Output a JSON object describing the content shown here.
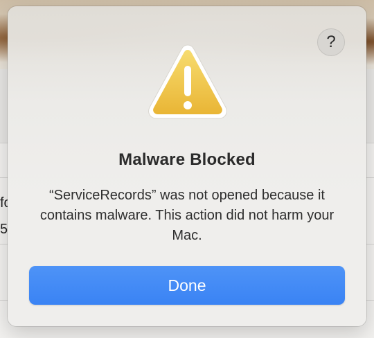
{
  "background": {
    "partial_text_line1": "fo",
    "partial_text_line2": "5"
  },
  "dialog": {
    "help_label": "?",
    "icon": "warning-triangle-icon",
    "title": "Malware Blocked",
    "message": "“ServiceRecords” was not opened because it contains malware. This action did not harm your Mac.",
    "done_label": "Done"
  },
  "colors": {
    "accent": "#3a83f4",
    "warning_yellow": "#f2c94c",
    "text": "#2b2b2b"
  }
}
